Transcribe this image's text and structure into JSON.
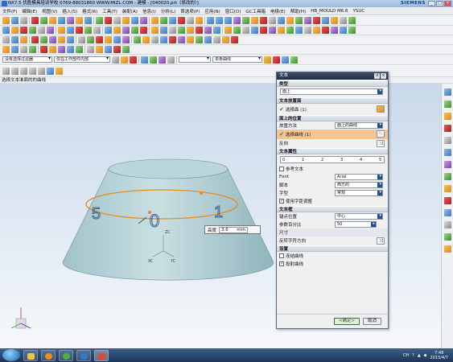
{
  "window": {
    "title": "NX7.5 优胜模具培训学校  0769-88031860 WWW.MIZL.COM - 建模 - [040020.prt（修改的）]",
    "brand": "SIEMENS"
  },
  "menu": [
    "文件(F)",
    "编辑(E)",
    "视图(V)",
    "插入(S)",
    "格式(R)",
    "工具(T)",
    "装配(A)",
    "信息(I)",
    "分析(L)",
    "首选项(P)",
    "应用(N)",
    "窗口(O)",
    "GC工具箱",
    "电极(E)",
    "帮助(H)",
    "HB_MOULD M6.6",
    "YSUC"
  ],
  "filters": {
    "selection_filter": "没有选择过滤器",
    "scope": "仅在工作部件内部",
    "curve_rule": "单条曲线"
  },
  "status_prompt": "选择文本准面的的曲线",
  "dialog": {
    "title": "文本",
    "type_section": "类型",
    "type_value": "面上",
    "face_section": "文本放置面",
    "face_selected": "选择面 (1)",
    "placement_section": "面上的位置",
    "placement_method_label": "放置方法",
    "placement_method_value": "面上的曲线",
    "curve_selected": "选择曲线 (1)",
    "reverse_label": "反向",
    "props_section": "文本属性",
    "scale_marks": [
      "0",
      "1",
      "2",
      "3",
      "4",
      "5"
    ],
    "ref_text": "参考文本",
    "font_label": "Font",
    "font_value": "Arial",
    "script_label": "脚本",
    "script_value": "西方的",
    "style_label": "字型",
    "style_value": "常规",
    "kerning": "使用字距调整",
    "frame_section": "文本框",
    "anchor_label": "锚点位置",
    "anchor_value": "中心",
    "param_label": "参数百分比",
    "param_value": "50",
    "dims_label": "尺寸",
    "reverse_char": "反转字符方向",
    "settings_section": "设置",
    "connect_text": "连结曲线",
    "project_curve": "投射曲线",
    "ok": "<确定>",
    "cancel": "取消"
  },
  "canvas": {
    "height_label": "高度",
    "height_value": "3.6",
    "height_unit": "mm",
    "digits": [
      "5",
      "0",
      "1"
    ],
    "axes": [
      "ZC",
      "XC",
      "YC"
    ]
  },
  "tray": {
    "lang": "CH",
    "time": "7:48",
    "date": "2015/4/7"
  },
  "colors": {
    "accent": "#1b4f9c",
    "highlight": "#f3c596",
    "ring": "#e8891c",
    "solid": "#b6d2d6"
  }
}
